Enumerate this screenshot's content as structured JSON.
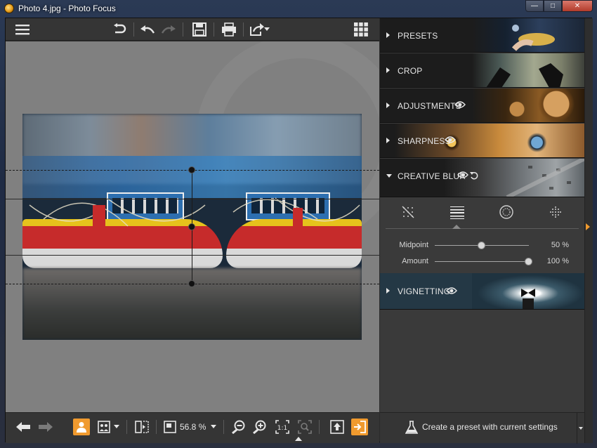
{
  "window": {
    "title": "Photo 4.jpg - Photo Focus",
    "controls": {
      "minimize": "—",
      "maximize": "□",
      "close": "✕"
    }
  },
  "toolbar": {
    "icons": [
      "menu-icon",
      "revert-icon",
      "undo-icon",
      "redo-icon",
      "save-icon",
      "print-icon",
      "share-icon",
      "chevron-down-icon",
      "grid-icon"
    ]
  },
  "panel": {
    "sections": [
      {
        "label": "PRESETS",
        "expanded": false,
        "eye": false,
        "art": "presets-art"
      },
      {
        "label": "CROP",
        "expanded": false,
        "eye": false,
        "art": "crop-art"
      },
      {
        "label": "ADJUSTMENTS",
        "expanded": false,
        "eye": true,
        "art": "adjustments-art"
      },
      {
        "label": "SHARPNESS",
        "expanded": false,
        "eye": true,
        "art": "sharpness-art"
      },
      {
        "label": "CREATIVE BLUR",
        "expanded": true,
        "eye": true,
        "reset": true,
        "art": "creative-blur-art"
      },
      {
        "label": "VIGNETTING",
        "expanded": false,
        "eye": true,
        "art": "vignetting-art"
      }
    ],
    "creative_blur": {
      "modes": [
        "no-blur-icon",
        "linear-blur-icon",
        "radial-blur-icon",
        "dot-blur-icon"
      ],
      "selected_mode": 1,
      "sliders": [
        {
          "label": "Midpoint",
          "value": 50,
          "display": "50 %"
        },
        {
          "label": "Amount",
          "value": 100,
          "display": "100 %"
        }
      ]
    }
  },
  "statusbar": {
    "zoom": "56.8 %",
    "icons": [
      "back-arrow-icon",
      "forward-arrow-icon",
      "person-icon",
      "compare-icon",
      "chevron-down-icon",
      "split-view-icon",
      "fit-icon",
      "chevron-down-icon",
      "zoom-out-icon",
      "zoom-in-icon",
      "actual-size-icon",
      "zoom-fit-icon",
      "export-icon",
      "exit-icon"
    ]
  },
  "preset_bar": {
    "label": "Create a preset with current settings"
  },
  "colors": {
    "accent": "#f09a2e",
    "panel": "#3a3a3a",
    "canvas": "#808080"
  }
}
